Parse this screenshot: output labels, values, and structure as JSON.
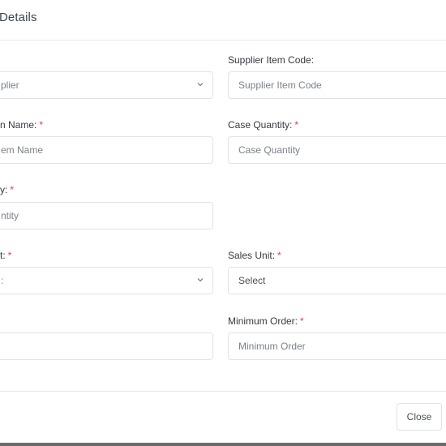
{
  "modal": {
    "title": "Details"
  },
  "fields": {
    "supplier": {
      "label": "",
      "value": "plier"
    },
    "supplier_item_code": {
      "label": "Supplier Item Code:",
      "placeholder": "Supplier Item Code"
    },
    "item_name": {
      "label": "n Name:",
      "required_mark": "*",
      "placeholder": "em Name"
    },
    "case_quantity": {
      "label": "Case Quantity:",
      "required_mark": "*",
      "placeholder": "Case Quantity"
    },
    "quantity": {
      "label": "y:",
      "required_mark": "*",
      "placeholder": "ntity"
    },
    "unit": {
      "label": "t:",
      "required_mark": "*",
      "value": ":"
    },
    "sales_unit": {
      "label": "Sales Unit:",
      "required_mark": "*",
      "value": "Select"
    },
    "left_bottom": {
      "value": ""
    },
    "minimum_order": {
      "label": "Minimum Order:",
      "required_mark": "*",
      "placeholder": "Minimum Order"
    }
  },
  "footer": {
    "close_label": "Close"
  },
  "icons": {
    "select_arrow": "chevron-down-icon"
  }
}
